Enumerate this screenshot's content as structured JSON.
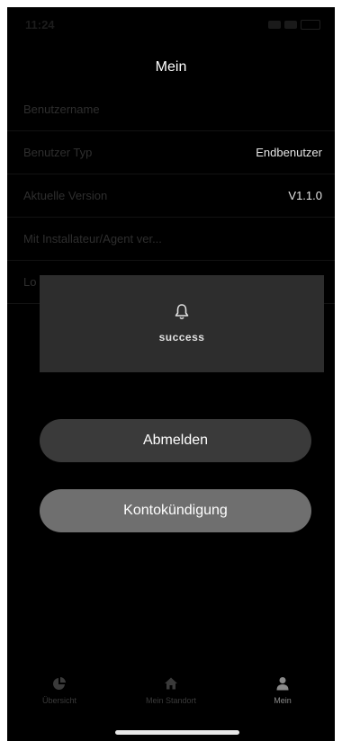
{
  "status_bar": {
    "time": "11:24"
  },
  "header": {
    "title": "Mein"
  },
  "rows": [
    {
      "label": "Benutzername",
      "value": ""
    },
    {
      "label": "Benutzer Typ",
      "value": "Endbenutzer"
    },
    {
      "label": "Aktuelle Version",
      "value": "V1.1.0"
    },
    {
      "label": "Mit Installateur/Agent ver...",
      "value": ""
    },
    {
      "label": "Lo",
      "value": ""
    }
  ],
  "toast": {
    "icon": "bell-icon",
    "text": "success"
  },
  "buttons": {
    "logout": "Abmelden",
    "delete_account": "Kontokündigung"
  },
  "tabs": [
    {
      "label": "Übersicht",
      "icon": "pie-chart-icon"
    },
    {
      "label": "Mein Standort",
      "icon": "home-icon"
    },
    {
      "label": "Mein",
      "icon": "person-icon"
    }
  ],
  "colors": {
    "background": "#000000",
    "toast": "#2d2d2d",
    "logout_button": "#3a3a3a",
    "delete_button": "#6f6f6f"
  }
}
